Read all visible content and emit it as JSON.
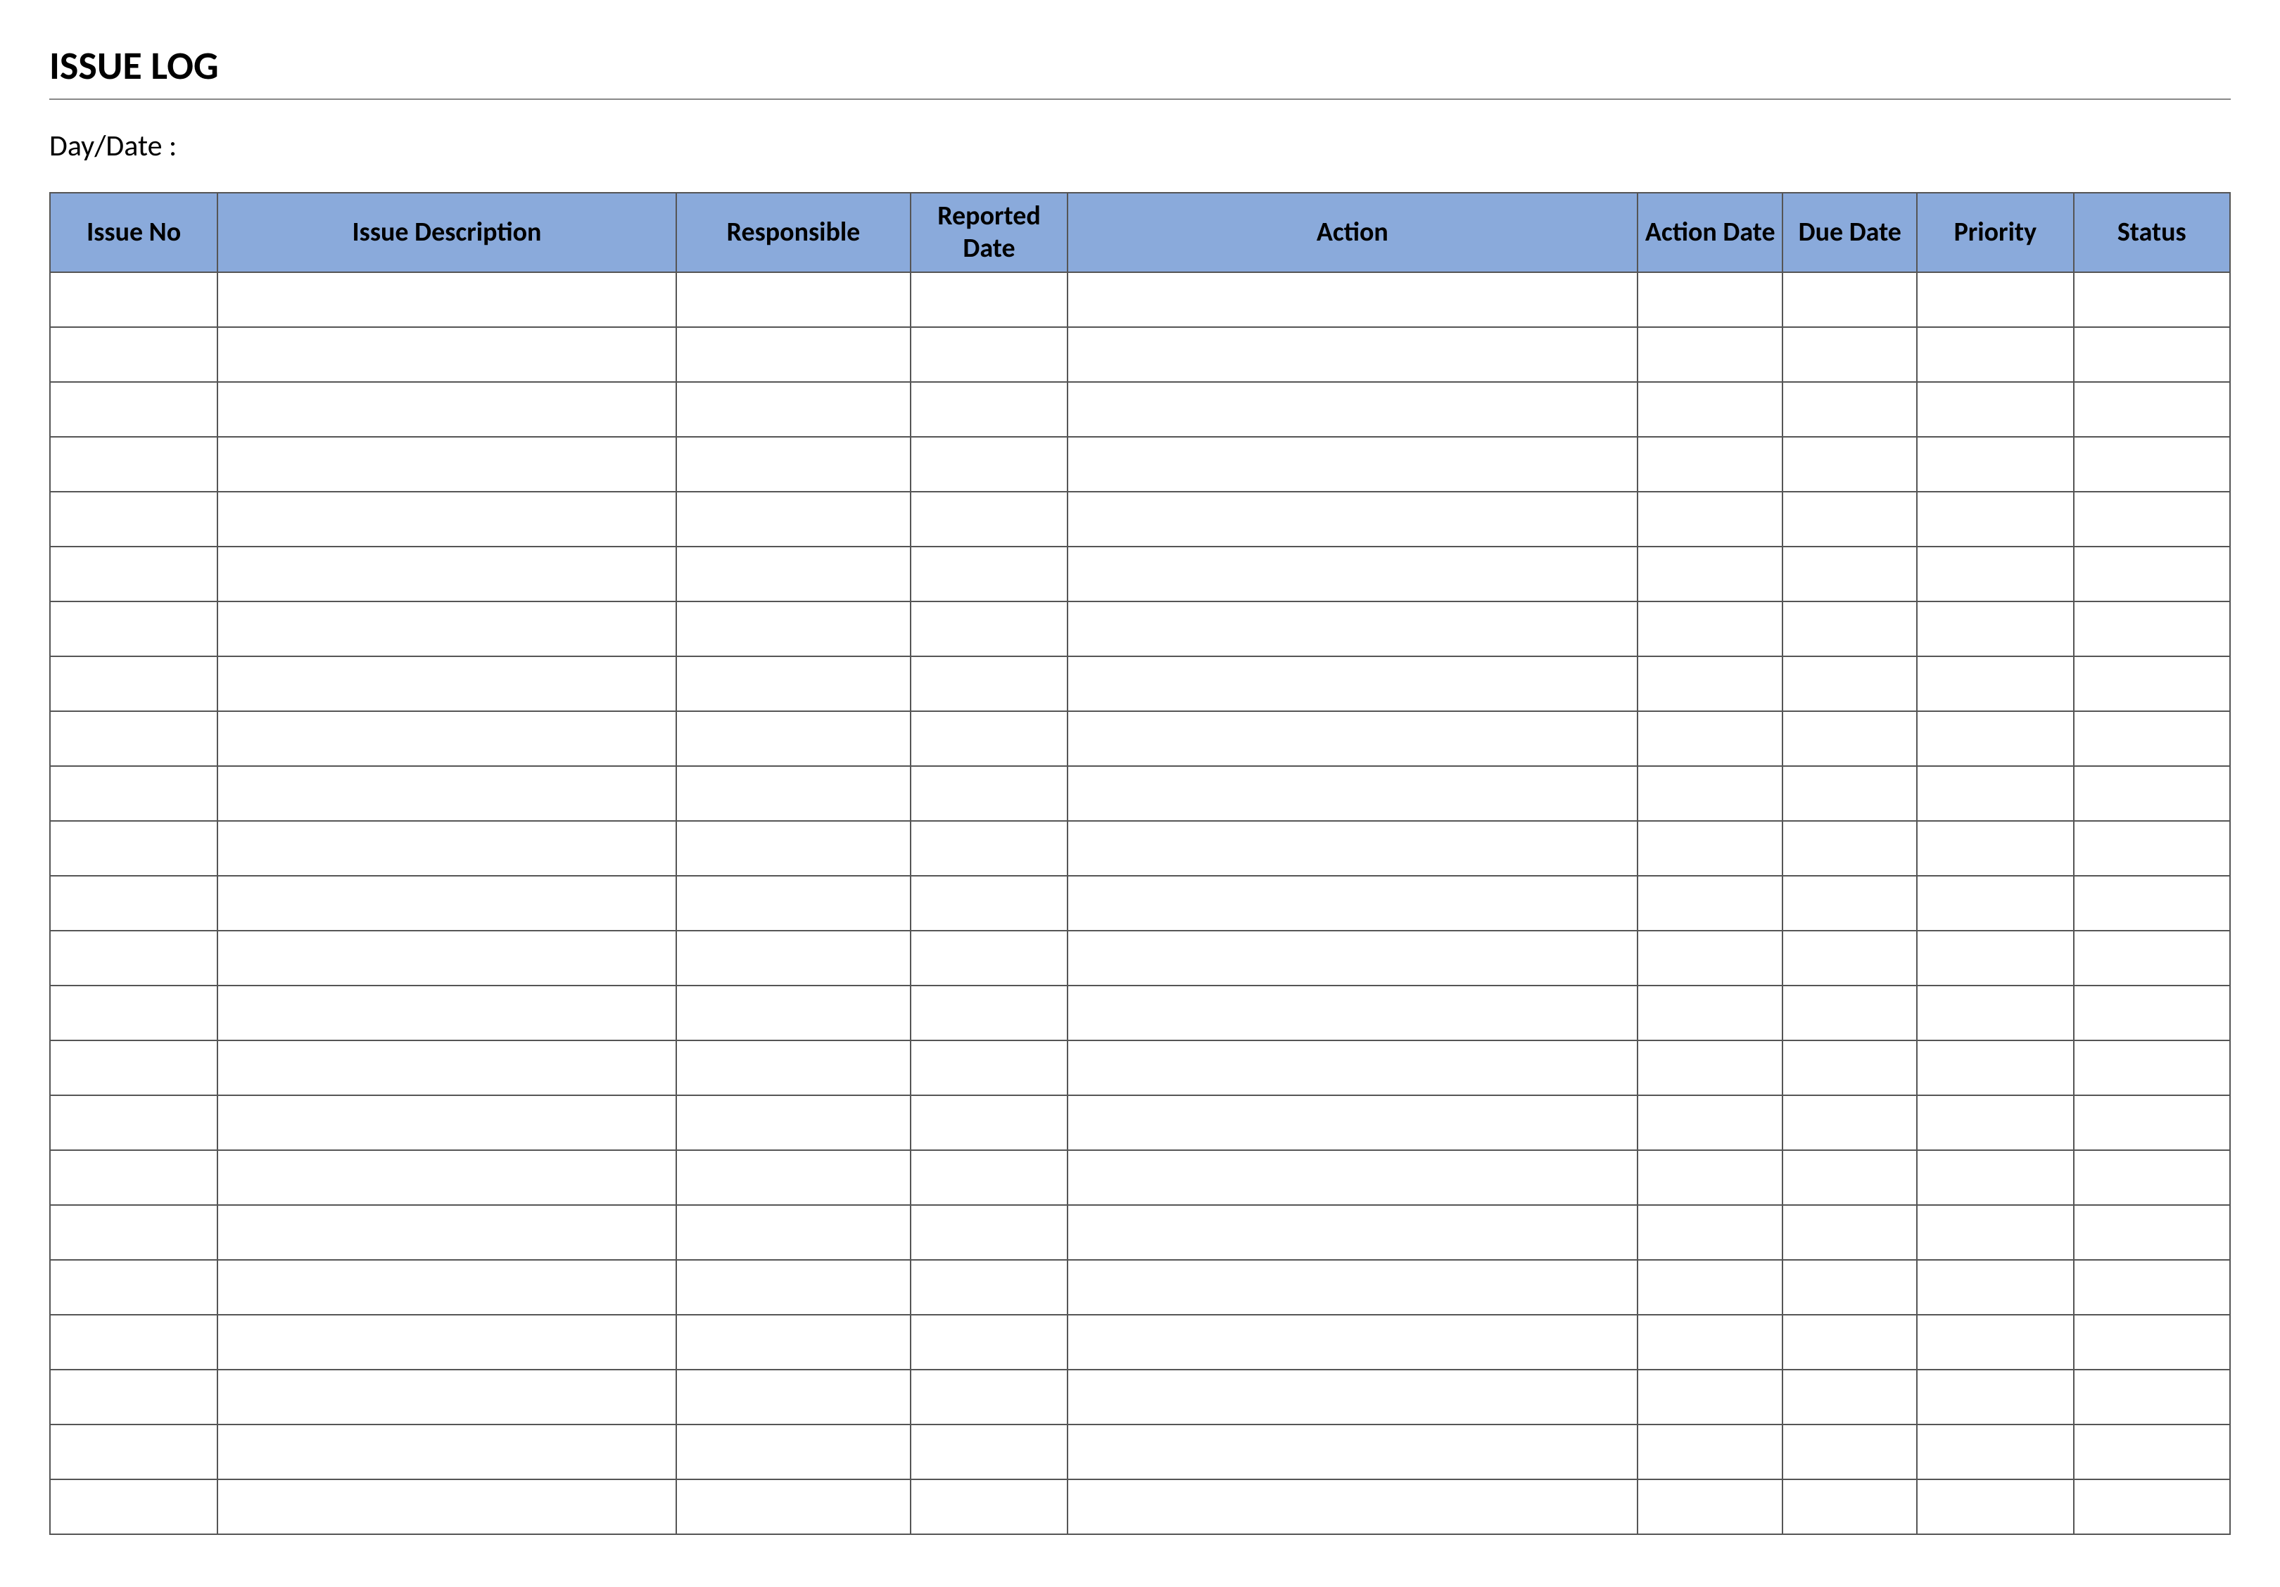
{
  "title": "ISSUE LOG",
  "daydate_label": "Day/Date :",
  "columns": {
    "issue_no": "Issue No",
    "issue_description": "Issue Description",
    "responsible": "Responsible",
    "reported_date": "Reported Date",
    "action": "Action",
    "action_date": "Action Date",
    "due_date": "Due Date",
    "priority": "Priority",
    "status": "Status"
  },
  "row_count": 23,
  "rows": [
    {
      "issue_no": "",
      "issue_description": "",
      "responsible": "",
      "reported_date": "",
      "action": "",
      "action_date": "",
      "due_date": "",
      "priority": "",
      "status": ""
    },
    {
      "issue_no": "",
      "issue_description": "",
      "responsible": "",
      "reported_date": "",
      "action": "",
      "action_date": "",
      "due_date": "",
      "priority": "",
      "status": ""
    },
    {
      "issue_no": "",
      "issue_description": "",
      "responsible": "",
      "reported_date": "",
      "action": "",
      "action_date": "",
      "due_date": "",
      "priority": "",
      "status": ""
    },
    {
      "issue_no": "",
      "issue_description": "",
      "responsible": "",
      "reported_date": "",
      "action": "",
      "action_date": "",
      "due_date": "",
      "priority": "",
      "status": ""
    },
    {
      "issue_no": "",
      "issue_description": "",
      "responsible": "",
      "reported_date": "",
      "action": "",
      "action_date": "",
      "due_date": "",
      "priority": "",
      "status": ""
    },
    {
      "issue_no": "",
      "issue_description": "",
      "responsible": "",
      "reported_date": "",
      "action": "",
      "action_date": "",
      "due_date": "",
      "priority": "",
      "status": ""
    },
    {
      "issue_no": "",
      "issue_description": "",
      "responsible": "",
      "reported_date": "",
      "action": "",
      "action_date": "",
      "due_date": "",
      "priority": "",
      "status": ""
    },
    {
      "issue_no": "",
      "issue_description": "",
      "responsible": "",
      "reported_date": "",
      "action": "",
      "action_date": "",
      "due_date": "",
      "priority": "",
      "status": ""
    },
    {
      "issue_no": "",
      "issue_description": "",
      "responsible": "",
      "reported_date": "",
      "action": "",
      "action_date": "",
      "due_date": "",
      "priority": "",
      "status": ""
    },
    {
      "issue_no": "",
      "issue_description": "",
      "responsible": "",
      "reported_date": "",
      "action": "",
      "action_date": "",
      "due_date": "",
      "priority": "",
      "status": ""
    },
    {
      "issue_no": "",
      "issue_description": "",
      "responsible": "",
      "reported_date": "",
      "action": "",
      "action_date": "",
      "due_date": "",
      "priority": "",
      "status": ""
    },
    {
      "issue_no": "",
      "issue_description": "",
      "responsible": "",
      "reported_date": "",
      "action": "",
      "action_date": "",
      "due_date": "",
      "priority": "",
      "status": ""
    },
    {
      "issue_no": "",
      "issue_description": "",
      "responsible": "",
      "reported_date": "",
      "action": "",
      "action_date": "",
      "due_date": "",
      "priority": "",
      "status": ""
    },
    {
      "issue_no": "",
      "issue_description": "",
      "responsible": "",
      "reported_date": "",
      "action": "",
      "action_date": "",
      "due_date": "",
      "priority": "",
      "status": ""
    },
    {
      "issue_no": "",
      "issue_description": "",
      "responsible": "",
      "reported_date": "",
      "action": "",
      "action_date": "",
      "due_date": "",
      "priority": "",
      "status": ""
    },
    {
      "issue_no": "",
      "issue_description": "",
      "responsible": "",
      "reported_date": "",
      "action": "",
      "action_date": "",
      "due_date": "",
      "priority": "",
      "status": ""
    },
    {
      "issue_no": "",
      "issue_description": "",
      "responsible": "",
      "reported_date": "",
      "action": "",
      "action_date": "",
      "due_date": "",
      "priority": "",
      "status": ""
    },
    {
      "issue_no": "",
      "issue_description": "",
      "responsible": "",
      "reported_date": "",
      "action": "",
      "action_date": "",
      "due_date": "",
      "priority": "",
      "status": ""
    },
    {
      "issue_no": "",
      "issue_description": "",
      "responsible": "",
      "reported_date": "",
      "action": "",
      "action_date": "",
      "due_date": "",
      "priority": "",
      "status": ""
    },
    {
      "issue_no": "",
      "issue_description": "",
      "responsible": "",
      "reported_date": "",
      "action": "",
      "action_date": "",
      "due_date": "",
      "priority": "",
      "status": ""
    },
    {
      "issue_no": "",
      "issue_description": "",
      "responsible": "",
      "reported_date": "",
      "action": "",
      "action_date": "",
      "due_date": "",
      "priority": "",
      "status": ""
    },
    {
      "issue_no": "",
      "issue_description": "",
      "responsible": "",
      "reported_date": "",
      "action": "",
      "action_date": "",
      "due_date": "",
      "priority": "",
      "status": ""
    },
    {
      "issue_no": "",
      "issue_description": "",
      "responsible": "",
      "reported_date": "",
      "action": "",
      "action_date": "",
      "due_date": "",
      "priority": "",
      "status": ""
    }
  ],
  "colors": {
    "header_bg": "#8AAADB",
    "border": "#555555"
  }
}
